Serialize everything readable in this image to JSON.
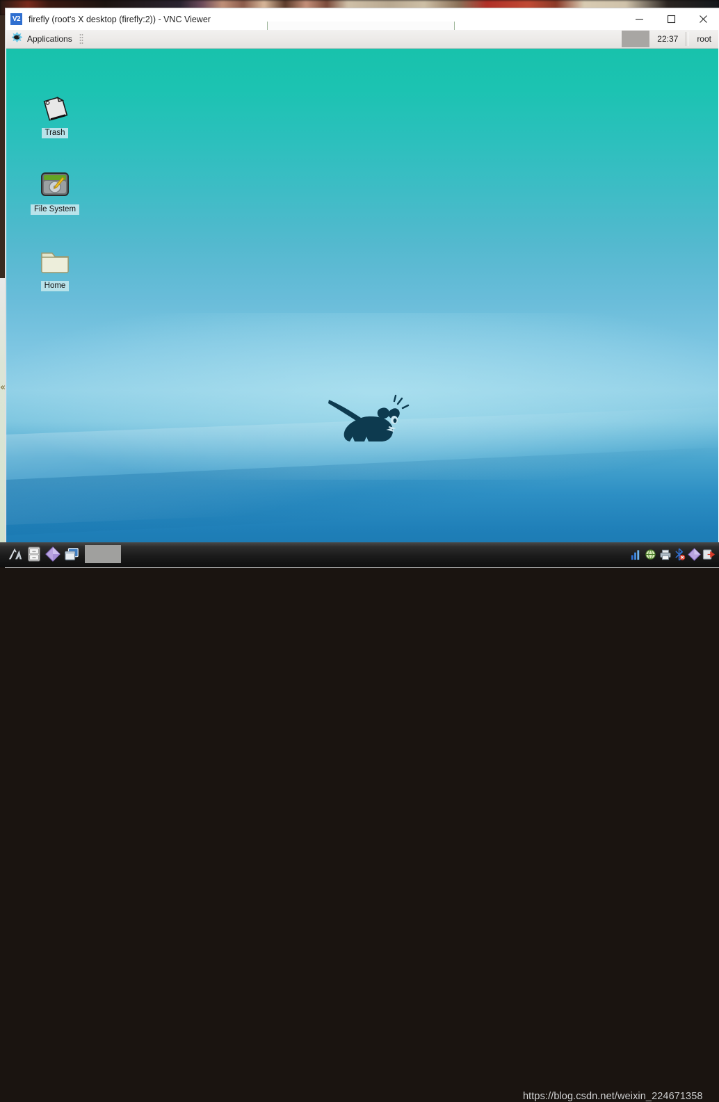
{
  "background": {
    "description": "blurred photo thumbnail strip behind window",
    "left_glyph": "«"
  },
  "window": {
    "app_logo_text": "V2",
    "title": "firefly (root's X desktop (firefly:2)) - VNC Viewer",
    "controls": {
      "minimize": "minimize",
      "maximize": "maximize",
      "close": "close"
    },
    "toolbar_tab": "vnc-collapsed-toolbar"
  },
  "xfce_panel": {
    "applications_label": "Applications",
    "clock": "22:37",
    "user": "root"
  },
  "desktop": {
    "icons": [
      {
        "id": "trash",
        "label": "Trash",
        "icon": "trash-icon"
      },
      {
        "id": "file-system",
        "label": "File System",
        "icon": "hard-drive-icon"
      },
      {
        "id": "home",
        "label": "Home",
        "icon": "folder-icon"
      }
    ],
    "logo": "xfce-mouse-logo",
    "wallpaper_colors": {
      "top": "#18c2ac",
      "middle": "#8fcfe6",
      "bottom": "#1a76ad"
    }
  },
  "dock": {
    "items": [
      {
        "id": "file-manager",
        "icon": "folder-icon"
      },
      {
        "id": "file-cabinet",
        "icon": "file-cabinet-icon"
      },
      {
        "id": "search",
        "icon": "magnifier-icon"
      },
      {
        "id": "folder-open",
        "icon": "folder-open-icon"
      }
    ]
  },
  "taskbar": {
    "items": [
      {
        "id": "vnc-viewer",
        "icon": "vnc-arrow-icon"
      },
      {
        "id": "file-explorer",
        "icon": "file-cabinet-icon"
      },
      {
        "id": "diamond-app",
        "icon": "diamond-icon"
      },
      {
        "id": "windows-app",
        "icon": "windows-stack-icon"
      }
    ],
    "gray_button": "window-list-button",
    "tray": [
      {
        "id": "chart",
        "icon": "bar-chart-icon"
      },
      {
        "id": "network",
        "icon": "globe-icon"
      },
      {
        "id": "printer",
        "icon": "printer-icon"
      },
      {
        "id": "bluetooth",
        "icon": "bluetooth-error-icon"
      },
      {
        "id": "diamond",
        "icon": "diamond-icon"
      },
      {
        "id": "share",
        "icon": "share-arrow-icon"
      }
    ]
  },
  "watermark": {
    "url": "https://blog.csdn.net",
    "suffix": "/weixin_224671358"
  }
}
